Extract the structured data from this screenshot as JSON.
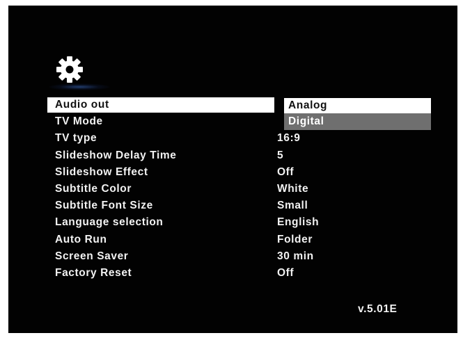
{
  "icons": {
    "settings": "gear-icon"
  },
  "colors": {
    "background": "#020202",
    "selection": "#ffffff",
    "dropdown_highlight": "#6f6f6f",
    "text": "#f2f2f2"
  },
  "menu": [
    {
      "label": "Audio out",
      "value": ""
    },
    {
      "label": "TV Mode",
      "value": ""
    },
    {
      "label": "TV type",
      "value": "16:9"
    },
    {
      "label": "Slideshow Delay Time",
      "value": "5"
    },
    {
      "label": "Slideshow Effect",
      "value": "Off"
    },
    {
      "label": "Subtitle Color",
      "value": "White"
    },
    {
      "label": "Subtitle Font Size",
      "value": "Small"
    },
    {
      "label": "Language selection",
      "value": "English"
    },
    {
      "label": "Auto Run",
      "value": "Folder"
    },
    {
      "label": "Screen Saver",
      "value": "30 min"
    },
    {
      "label": "Factory Reset",
      "value": "Off"
    }
  ],
  "dropdown": {
    "options": [
      "Analog",
      "Digital"
    ]
  },
  "version": "v.5.01E"
}
